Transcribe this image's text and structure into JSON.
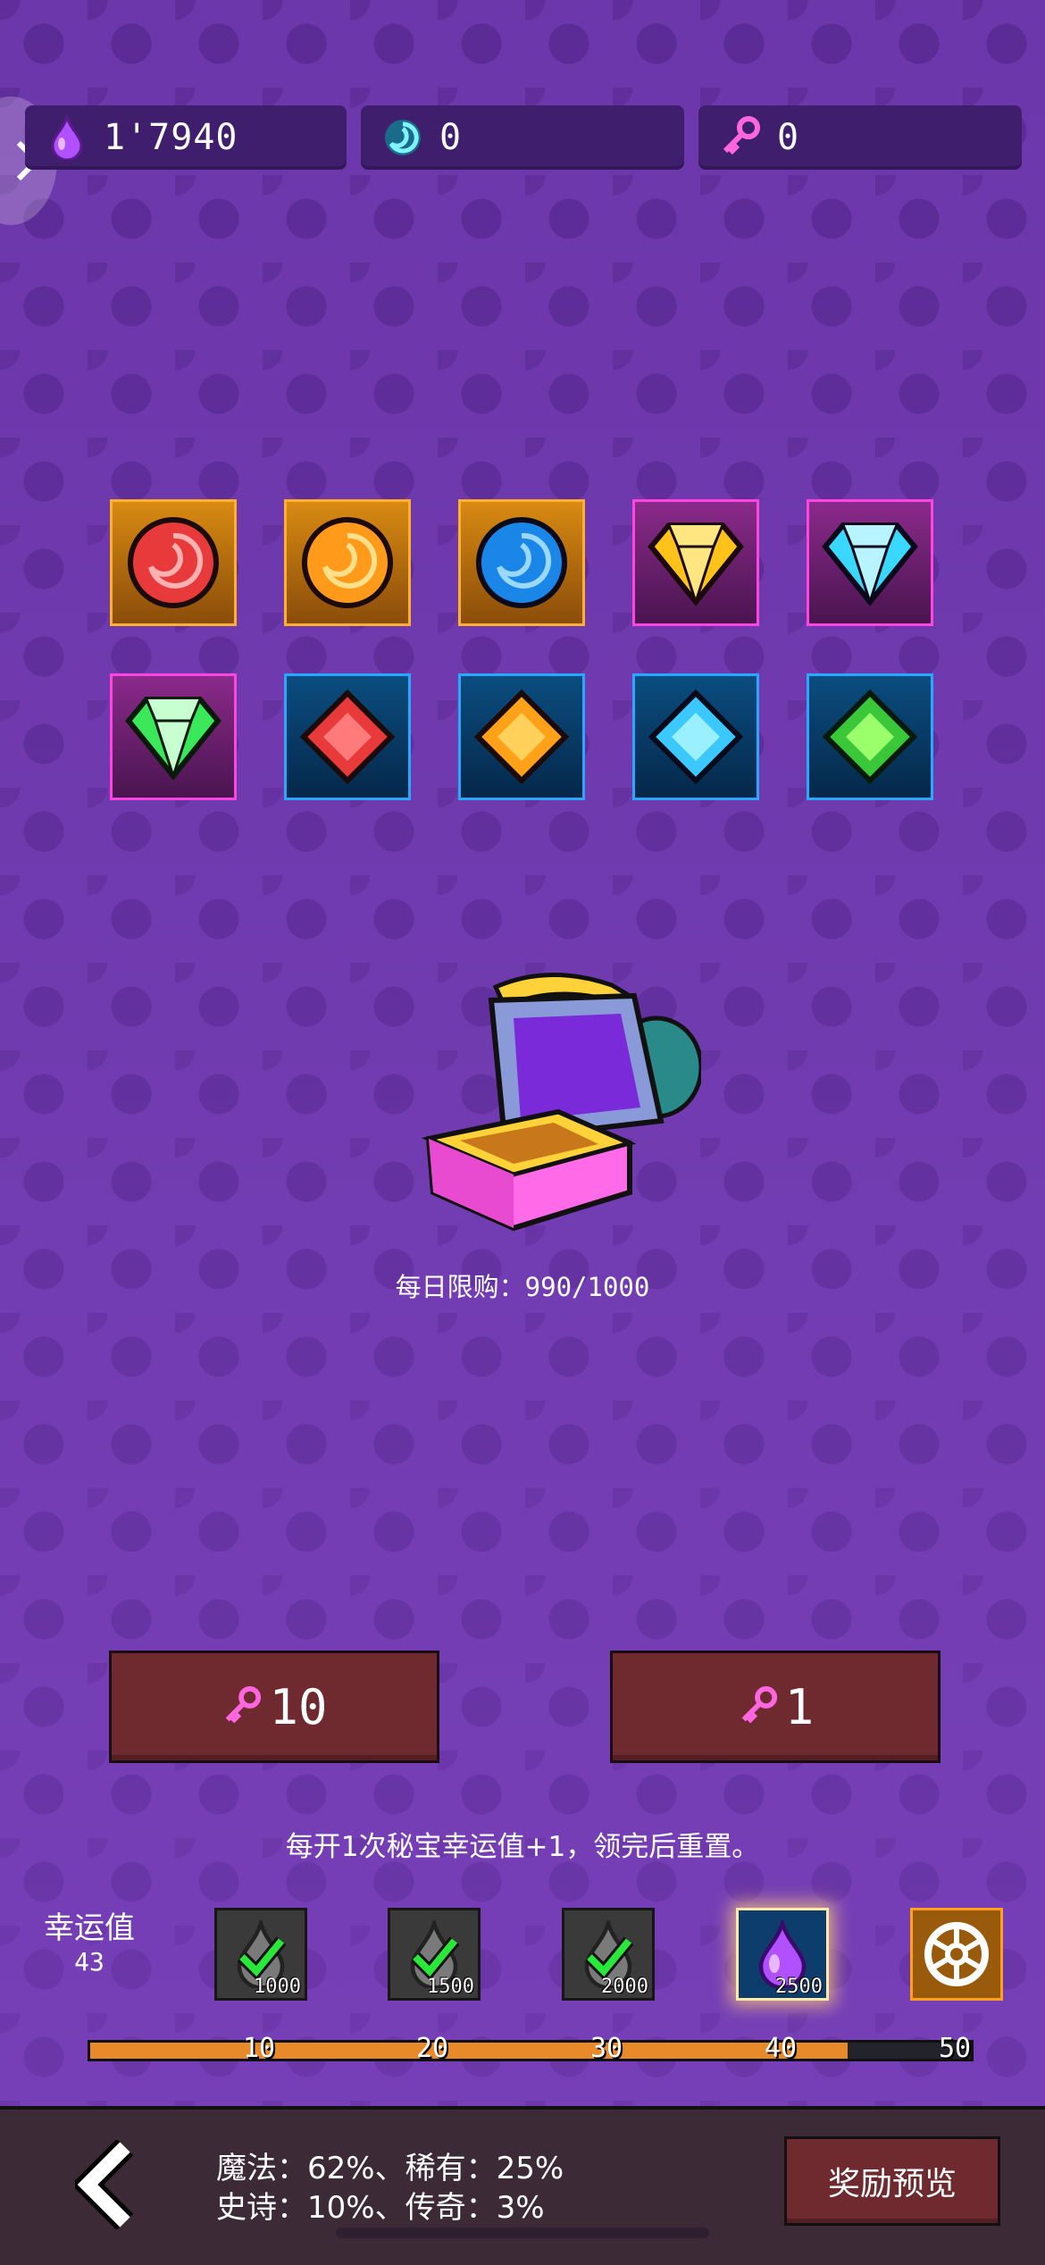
{
  "resources": [
    {
      "icon": "purple-drop-icon",
      "value": "1'7940"
    },
    {
      "icon": "blue-swirl-icon",
      "value": "0"
    },
    {
      "icon": "pink-key-icon",
      "value": "0"
    }
  ],
  "gems": [
    {
      "icon": "red-orb-icon",
      "rarity": "orange"
    },
    {
      "icon": "orange-orb-icon",
      "rarity": "orange"
    },
    {
      "icon": "blue-orb-icon",
      "rarity": "orange"
    },
    {
      "icon": "yellow-diamond-icon",
      "rarity": "pink"
    },
    {
      "icon": "cyan-diamond-icon",
      "rarity": "pink"
    },
    {
      "icon": "green-diamond-icon",
      "rarity": "pink"
    },
    {
      "icon": "red-gem-icon",
      "rarity": "blue"
    },
    {
      "icon": "orange-gem-icon",
      "rarity": "blue"
    },
    {
      "icon": "cyan-gem-icon",
      "rarity": "blue"
    },
    {
      "icon": "green-gem-icon",
      "rarity": "blue"
    }
  ],
  "chest": {
    "icon": "treasure-chest-icon",
    "daily_limit": "每日限购：990/1000"
  },
  "buttons": {
    "open_ten": "10",
    "open_one": "1"
  },
  "hint": "每开1次秘宝幸运值+1，领完后重置。",
  "luck": {
    "label": "幸运值",
    "value": "43",
    "rewards": [
      {
        "amount": "1000",
        "claimed": true
      },
      {
        "amount": "1500",
        "claimed": true
      },
      {
        "amount": "2000",
        "claimed": true
      },
      {
        "amount": "2500",
        "claimed": false
      },
      {
        "amount": "",
        "claimed": false
      }
    ],
    "ticks": [
      "10",
      "20",
      "30",
      "40",
      "50"
    ],
    "progress": 43,
    "max": 50
  },
  "footer": {
    "odds_line1": "魔法：62%、稀有：25%",
    "odds_line2": "史诗：10%、传奇：3%",
    "preview": "奖励预览"
  }
}
